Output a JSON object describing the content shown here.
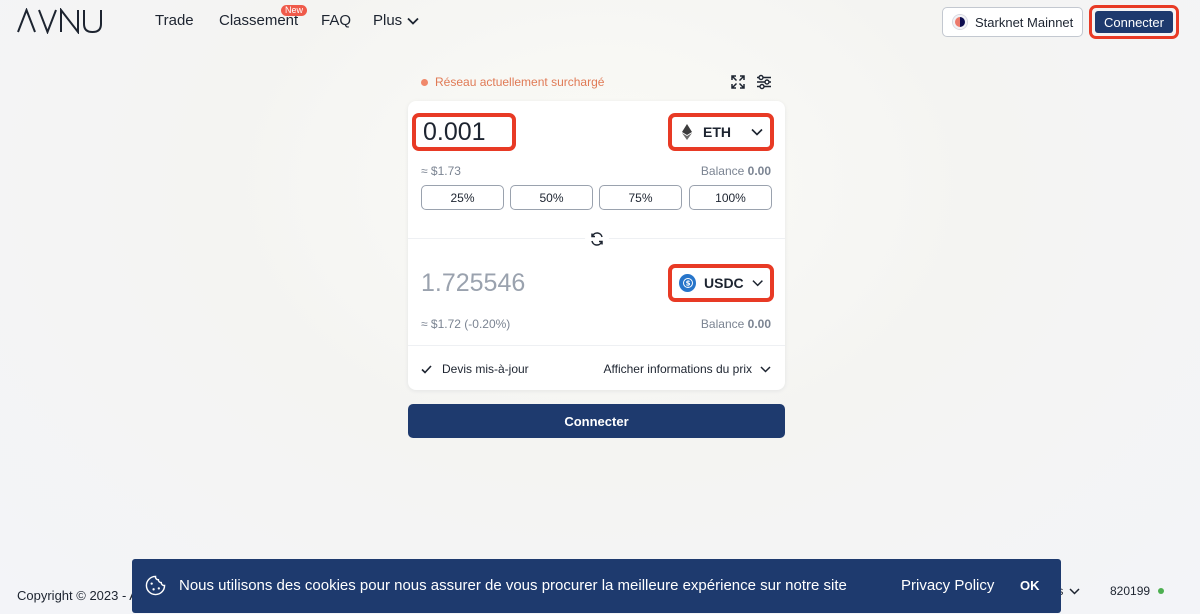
{
  "header": {
    "logo": "AVNU",
    "nav": {
      "trade": "Trade",
      "classement": "Classement",
      "new_badge": "New",
      "faq": "FAQ",
      "plus": "Plus"
    },
    "network_label": "Starknet Mainnet",
    "connect_label": "Connecter"
  },
  "swap": {
    "status_text": "Réseau actuellement surchargé",
    "from": {
      "amount": "0.001",
      "token": "ETH",
      "fiat": "≈ $1.73",
      "balance_label": "Balance",
      "balance_value": "0.00"
    },
    "percent_buttons": [
      "25%",
      "50%",
      "75%",
      "100%"
    ],
    "to": {
      "amount": "1.725546",
      "token": "USDC",
      "fiat": "≈ $1.72 (-0.20%)",
      "balance_label": "Balance",
      "balance_value": "0.00"
    },
    "quote_status": "Devis mis-à-jour",
    "price_info_label": "Afficher informations du prix",
    "connect_label": "Connecter"
  },
  "footer": {
    "copyright": "Copyright © 2023 - A",
    "language_partial": "ais",
    "block_number": "820199"
  },
  "cookie_banner": {
    "text": "Nous utilisons des cookies pour nous assurer de vous procurer la meilleure expérience sur notre site",
    "policy_label": "Privacy Policy",
    "ok_label": "OK"
  },
  "colors": {
    "primary": "#1e3a6e",
    "highlight": "#e83a25",
    "warning": "#e07a55",
    "online": "#4caf50"
  }
}
